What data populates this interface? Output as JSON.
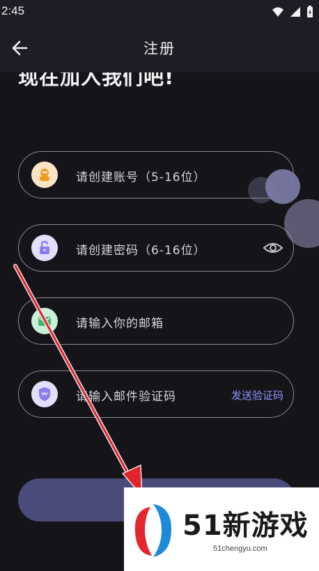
{
  "status_bar": {
    "time": "2:45"
  },
  "app_bar": {
    "title": "注册"
  },
  "headline": "现在加入我们吧!",
  "fields": {
    "account": {
      "label": "请创建账号（5-16位）"
    },
    "password": {
      "label": "请创建密码（6-16位）"
    },
    "email": {
      "label": "请输入你的邮箱"
    },
    "code": {
      "label": "请输入邮件验证码",
      "action": "发送验证码"
    }
  },
  "colors": {
    "background": "#151419",
    "app_bar": "#1e1d25",
    "accent_link": "#8f94ff",
    "submit_button": "#4a4b7a",
    "annotation_arrow": "#e0242a"
  },
  "watermark": {
    "brand": "51新游戏",
    "url": "51chengyu.com"
  }
}
